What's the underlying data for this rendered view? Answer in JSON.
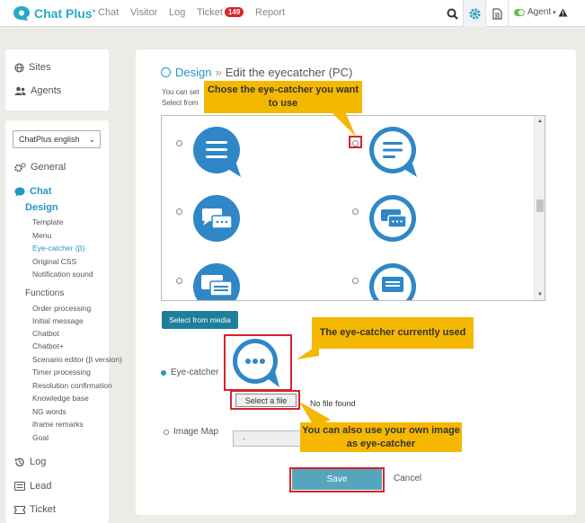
{
  "topbar": {
    "logo": "Chat Plus",
    "logo_mark": "+",
    "nav": [
      "Chat",
      "Visitor",
      "Log",
      "Ticket",
      "Report"
    ],
    "ticket_count": "149",
    "agent_status": "Agent",
    "icons": [
      "search-icon",
      "gear-icon",
      "document-icon",
      "warning-icon"
    ]
  },
  "sidebar": {
    "top_links": [
      "Sites",
      "Agents"
    ],
    "site_select": "ChatPlus english",
    "general_label": "General",
    "chat_label": "Chat",
    "design_label": "Design",
    "design_items": [
      "Template",
      "Menu",
      "Eye-catcher (β)",
      "Original CSS",
      "Notification sound"
    ],
    "functions_label": "Functions",
    "function_items": [
      "Order processing",
      "Initial message",
      "Chatbot",
      "Chatbot+",
      "Scenario editor (β version)",
      "Timer processing",
      "Resolution confirmation",
      "Knowledge base",
      "NG words",
      "iframe remarks",
      "Goal"
    ],
    "bottom_links": [
      "Log",
      "Lead",
      "Ticket"
    ]
  },
  "main": {
    "breadcrumb_link": "Design",
    "breadcrumb_sep": "»",
    "page_title": "Edit the eyecatcher (PC)",
    "hint_line1": "You can set",
    "hint_line2": "Select from",
    "select_media_button": "Select from media",
    "eyecatcher_label": "Eye-catcher",
    "select_file_button": "Select a file",
    "no_file_text": "No file found",
    "image_map_label": "Image Map",
    "image_map_value": "-",
    "save_button": "Save",
    "cancel_link": "Cancel"
  },
  "annotations": {
    "choose": "Chose the eye-catcher you want to use",
    "current": "The eye-catcher currently used",
    "own_image": "You can also use your own image as eye-catcher"
  },
  "colors": {
    "brand": "#29a9c7",
    "primary_dark": "#1e7f99",
    "callout": "#f5b800",
    "annotation_red": "#d6232a",
    "bubble_blue": "#2f87c7",
    "badge_red": "#d9232d"
  }
}
